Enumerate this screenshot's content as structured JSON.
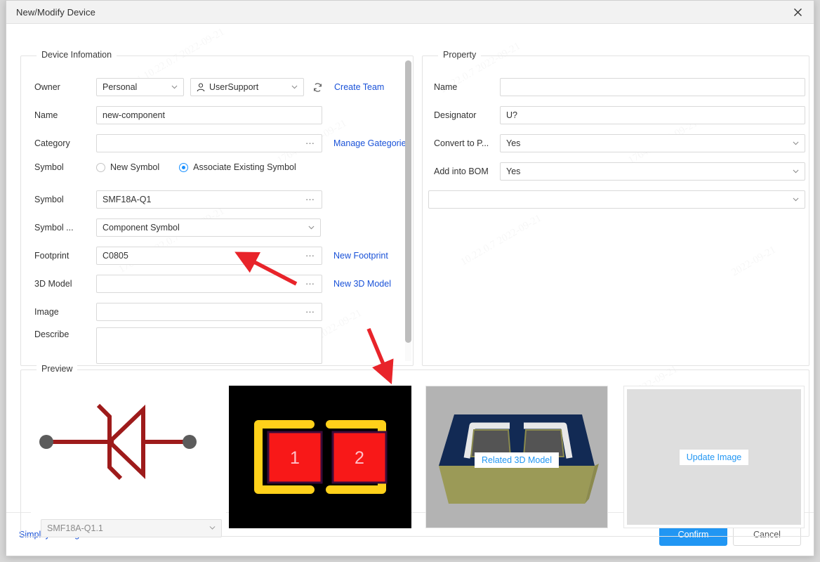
{
  "window": {
    "title": "New/Modify Device",
    "close_icon": "close-icon"
  },
  "device_information": {
    "legend": "Device Infomation",
    "owner": {
      "label": "Owner",
      "scope_value": "Personal",
      "user_value": "UserSupport",
      "user_icon": "user-icon",
      "refresh_icon": "refresh-icon",
      "create_team_link": "Create Team"
    },
    "name": {
      "label": "Name",
      "value": "new-component"
    },
    "category": {
      "label": "Category",
      "value": "",
      "browse_icon": "ellipsis-icon",
      "manage_link": "Manage Gategories"
    },
    "symbol_mode": {
      "label": "Symbol",
      "option_new": "New Symbol",
      "option_associate": "Associate Existing Symbol",
      "selected": "Associate Existing Symbol"
    },
    "symbol": {
      "label": "Symbol",
      "value": "SMF18A-Q1",
      "browse_icon": "ellipsis-icon"
    },
    "symbol_type": {
      "label": "Symbol ...",
      "value": "Component Symbol"
    },
    "footprint": {
      "label": "Footprint",
      "value": "C0805",
      "browse_icon": "ellipsis-icon",
      "new_link": "New Footprint"
    },
    "model3d": {
      "label": "3D Model",
      "value": "",
      "browse_icon": "ellipsis-icon",
      "new_link": "New 3D Model"
    },
    "image": {
      "label": "Image",
      "value": "",
      "browse_icon": "ellipsis-icon"
    },
    "describe": {
      "label": "Describe",
      "value": ""
    }
  },
  "property": {
    "legend": "Property",
    "name": {
      "label": "Name",
      "value": ""
    },
    "designator": {
      "label": "Designator",
      "value": "U?"
    },
    "convert_to_pcb": {
      "label": "Convert to P...",
      "value": "Yes"
    },
    "add_into_bom": {
      "label": "Add into BOM",
      "value": "Yes"
    },
    "extra_select": {
      "value": ""
    }
  },
  "preview": {
    "legend": "Preview",
    "symbol_select_value": "SMF18A-Q1.1",
    "footprint_pads": [
      "1",
      "2"
    ],
    "model3d_badge": "Related 3D Model",
    "update_image_button": "Update Image"
  },
  "footer": {
    "simplify_setting_link": "Simplify Setting>",
    "confirm_button": "Confirm",
    "cancel_button": "Cancel"
  },
  "watermarks": [
    "17641  10.22.0.7  2022-09-21",
    "10.22.0.7 2022-09-21",
    "17641 2022-09-21",
    "10.22.0.7",
    "2022-09-21"
  ],
  "colors": {
    "link": "#1a52d8",
    "accent": "#2196f3",
    "radio_on": "#1890ff",
    "symbol_red": "#9e1b1b",
    "pad_red": "#f81818",
    "pad_outline": "#ffd11a",
    "annotation_arrow": "#e8242a"
  }
}
